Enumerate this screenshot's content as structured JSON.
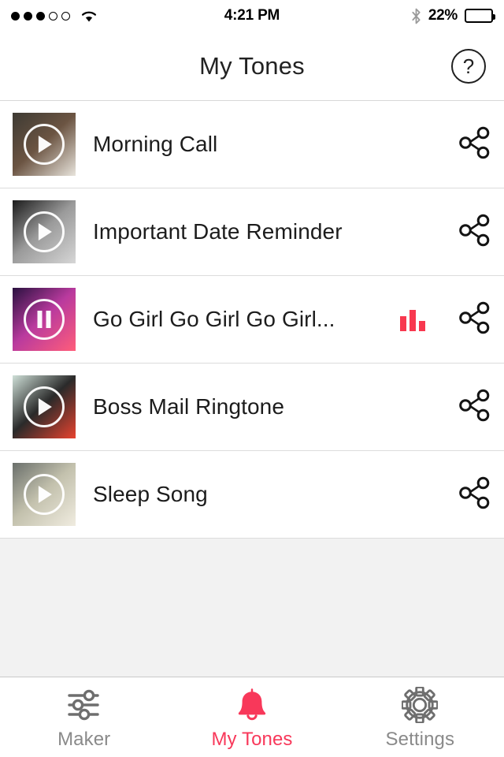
{
  "status_bar": {
    "signal_filled": 3,
    "signal_empty": 2,
    "wifi_icon": "wifi-icon",
    "time": "4:21 PM",
    "bluetooth_icon": "bluetooth-icon",
    "battery_percent": "22%",
    "battery_level": 22
  },
  "navbar": {
    "title": "My Tones",
    "help_label": "?",
    "help_icon": "help-circle-icon"
  },
  "list": {
    "rows": [
      {
        "title": "Morning Call",
        "state": "paused",
        "playing": false,
        "thumb_icon": "play-icon",
        "share_icon": "share-icon",
        "thumb_colors": [
          "#3d3a33",
          "#6b5442",
          "#e8e4dc"
        ]
      },
      {
        "title": "Important Date Reminder",
        "state": "paused",
        "playing": false,
        "thumb_icon": "play-icon",
        "share_icon": "share-icon",
        "thumb_colors": [
          "#1b1b1b",
          "#9a9a9a",
          "#d6d6d6"
        ]
      },
      {
        "title": "Go Girl Go Girl Go Girl...",
        "state": "playing",
        "playing": true,
        "thumb_icon": "pause-icon",
        "share_icon": "share-icon",
        "equalizer_icon": "equalizer-icon",
        "equalizer_bars": [
          19,
          27,
          13
        ],
        "thumb_colors": [
          "#2a1140",
          "#b93a9e",
          "#ff5d7a"
        ]
      },
      {
        "title": "Boss Mail Ringtone",
        "state": "paused",
        "playing": false,
        "thumb_icon": "play-icon",
        "share_icon": "share-icon",
        "thumb_colors": [
          "#cfe0d8",
          "#2a2a2a",
          "#e8432f"
        ]
      },
      {
        "title": "Sleep Song",
        "state": "paused",
        "playing": false,
        "thumb_icon": "play-icon",
        "share_icon": "share-icon",
        "thumb_colors": [
          "#6a6f6b",
          "#c3c1ad",
          "#f0ece0"
        ]
      }
    ]
  },
  "tabbar": {
    "tabs": [
      {
        "label": "Maker",
        "icon": "sliders-icon",
        "active": false
      },
      {
        "label": "My Tones",
        "icon": "bell-icon",
        "active": true
      },
      {
        "label": "Settings",
        "icon": "gear-icon",
        "active": false
      }
    ]
  },
  "colors": {
    "accent": "#f8385a",
    "equalizer": "#f8384f",
    "text_primary": "#1c1c1c",
    "text_muted": "#8a8a8a",
    "separator": "#dcdcdc",
    "empty_background": "#f2f2f2"
  }
}
